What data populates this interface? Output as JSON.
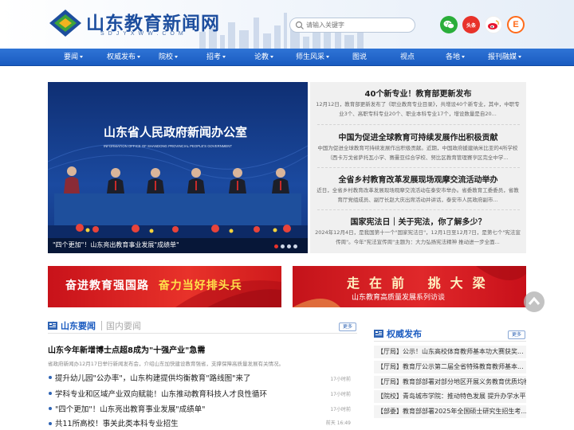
{
  "site": {
    "name": "山东教育新闻网",
    "domain": "SDJYXWW.COM"
  },
  "search": {
    "placeholder": "请输入关键字"
  },
  "share": [
    {
      "icon": "wechat-icon",
      "color": "#2aae3a"
    },
    {
      "icon": "toutiao-icon",
      "label": "头条",
      "color": "#e8322a"
    },
    {
      "icon": "weibo-icon",
      "color": "#e6162d"
    },
    {
      "icon": "e-icon",
      "label": "E",
      "color": "#ff6b1a"
    }
  ],
  "nav": [
    {
      "label": "要闻",
      "dropdown": true
    },
    {
      "label": "权威发布",
      "dropdown": true
    },
    {
      "label": "院校",
      "dropdown": true
    },
    {
      "label": "招考",
      "dropdown": true
    },
    {
      "label": "论教",
      "dropdown": true
    },
    {
      "label": "师生风采",
      "dropdown": true
    },
    {
      "label": "图说",
      "dropdown": false
    },
    {
      "label": "视点",
      "dropdown": false
    },
    {
      "label": "各地",
      "dropdown": true
    },
    {
      "label": "报刊融媒",
      "dropdown": true
    }
  ],
  "carousel": {
    "backdrop_cn": "山东省人民政府新闻办公室",
    "backdrop_en": "INFORMATION OFFICE OF SHANDONG PROVINCIAL PEOPLE'S GOVERNMENT",
    "caption": "\"四个更加\"！山东亮出教育事业发展\"成绩单\"",
    "slide_count": 4,
    "active_slide": 1
  },
  "headlines": [
    {
      "title": "40个新专业！教育部更新发布",
      "summary": "12月12日，教育部更新发布了《职业教育专业目录》，共增设40个新专业，其中，中职专业3个、高职专科专业20个、职业本科专业17个，增设数量是自20..."
    },
    {
      "title": "中国为促进全球教育可持续发展作出积极贡献",
      "summary": "中国为促进全球教育可持续发展作出积极贡献。近期，中国政府援建纳米比亚的4所学校（西卡万戈省萨托瓦小学、赛曼亚综合学校、努比区教育管理赛亨区完全中学..."
    },
    {
      "title": "全省乡村教育改革发展现场观摩交流活动举办",
      "summary": "近日，全省乡村教育改革发展现场观摩交流活动在泰安市举办。省委教育工委委员，省教育厅党组成员、副厅长赵大庆出席活动并讲话，泰安市人民政府副市..."
    },
    {
      "title": "国家宪法日｜关于宪法，你了解多少？",
      "summary": "2024年12月4日，是我国第十一个\"国家宪法日\"，12月1日至12月7日，是第七个\"宪法宣传周\"。今年\"宪法宣传周\"主题为：大力弘扬宪法精神 推动进一步全面..."
    }
  ],
  "banners": {
    "left": {
      "part1": "奋进教育强国路",
      "part2": "奋力当好排头兵"
    },
    "right": {
      "title": "走在前 挑大梁",
      "subtitle": "山东教育高质量发展系列访谈"
    }
  },
  "news_section": {
    "active_tab": "山东要闻",
    "inactive_tab": "国内要闻",
    "more": "更多",
    "lead": {
      "title": "山东今年新增博士点超8成为\"十强产业\"急需",
      "summary": "省政府新闻办12月17日举行新闻发布会，介绍山东加快建设教育强省，支撑保障高质量发展有关情况。"
    },
    "items": [
      {
        "title": "提升幼儿园\"公办率\"，山东构建提供均衡教育\"路线图\"来了",
        "time": "17小时前"
      },
      {
        "title": "学科专业和区域产业双向赋能！山东推动教育科技人才良性循环",
        "time": "17小时前"
      },
      {
        "title": "\"四个更加\"！山东亮出教育事业发展\"成绩单\"",
        "time": "17小时前"
      },
      {
        "title": "共11所高校！事关此类本科专业招生",
        "time": "前天 16:49"
      }
    ]
  },
  "authority_section": {
    "title": "权威发布",
    "more": "更多",
    "items": [
      "【厅局】公示！山东高校体育教师基本功大赛获奖...",
      "【厅局】教育厅公示第二届全省特殊教育教师基本...",
      "【厅局】教育部部署对部分地区开展义务教育优质均衡...",
      "【院校】青岛城市学院：推动特色发展 提升办学水平",
      "【部委】教育部部署2025年全国硕士研究生招生考..."
    ]
  }
}
